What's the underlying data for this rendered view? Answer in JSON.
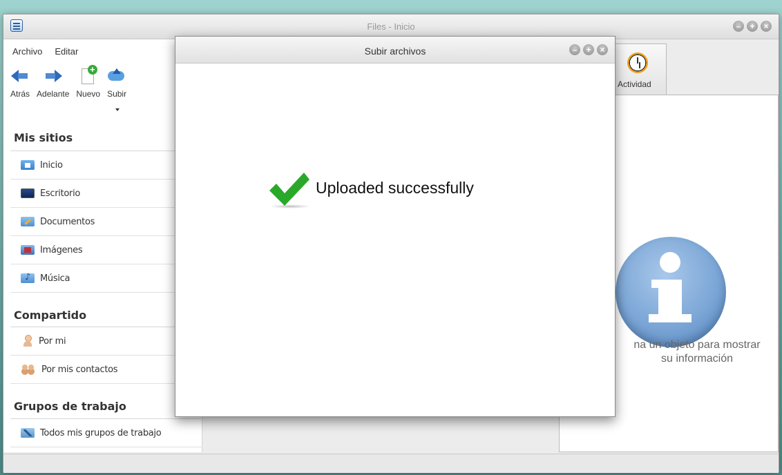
{
  "window": {
    "title": "Files - Inicio",
    "controls": [
      "minimize",
      "maximize",
      "close"
    ]
  },
  "menu": {
    "items": [
      "Archivo",
      "Editar"
    ]
  },
  "toolbar": {
    "buttons": [
      {
        "label": "Atrás",
        "icon": "back-arrow-icon"
      },
      {
        "label": "Adelante",
        "icon": "forward-arrow-icon"
      },
      {
        "label": "Nuevo",
        "icon": "new-document-icon"
      },
      {
        "label": "Subir",
        "icon": "upload-cloud-icon"
      }
    ]
  },
  "sidebar": {
    "sections": [
      {
        "title": "Mis sitios",
        "items": [
          {
            "label": "Inicio",
            "icon": "home-folder-icon"
          },
          {
            "label": "Escritorio",
            "icon": "desktop-folder-icon"
          },
          {
            "label": "Documentos",
            "icon": "documents-folder-icon"
          },
          {
            "label": "Imágenes",
            "icon": "images-folder-icon"
          },
          {
            "label": "Música",
            "icon": "music-folder-icon"
          }
        ]
      },
      {
        "title": "Compartido",
        "items": [
          {
            "label": "Por mi",
            "icon": "user-icon"
          },
          {
            "label": "Por mis contactos",
            "icon": "contacts-icon"
          }
        ]
      },
      {
        "title": "Grupos de trabajo",
        "items": [
          {
            "label": "Todos mis grupos de trabajo",
            "icon": "workgroups-icon"
          }
        ]
      }
    ]
  },
  "right_panel": {
    "tab_label": "Actividad",
    "info_line1": "na un objeto para mostrar",
    "info_line2": "su información"
  },
  "dialog": {
    "title": "Subir archivos",
    "message": "Uploaded successfully",
    "accent_color": "#2aa82a"
  }
}
